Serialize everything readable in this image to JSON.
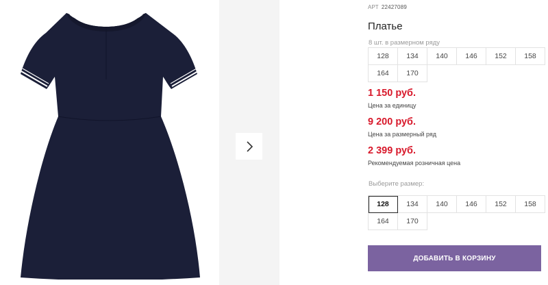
{
  "product": {
    "article_label": "АРТ",
    "article_value": "22427089",
    "title": "Платье",
    "pack_label": "8 шт. в размерном ряду",
    "pack_sizes": [
      "128",
      "134",
      "140",
      "146",
      "152",
      "158",
      "164",
      "170"
    ],
    "unit_price": "1 150 руб.",
    "unit_price_label": "Цена за единицу",
    "pack_price": "9 200 руб.",
    "pack_price_label": "Цена за размерный ряд",
    "retail_price": "2 399 руб.",
    "retail_price_label": "Рекомендуемая розничная цена",
    "choose_size_label": "Выберите размер:",
    "sizes": [
      "128",
      "134",
      "140",
      "146",
      "152",
      "158",
      "164",
      "170"
    ],
    "selected_size": "128",
    "add_to_cart_label": "ДОБАВИТЬ В КОРЗИНУ"
  },
  "gallery": {
    "next_icon": "chevron-right-icon"
  },
  "colors": {
    "price": "#d8192b",
    "button": "#7b63a0",
    "dress": "#1b1f38"
  }
}
